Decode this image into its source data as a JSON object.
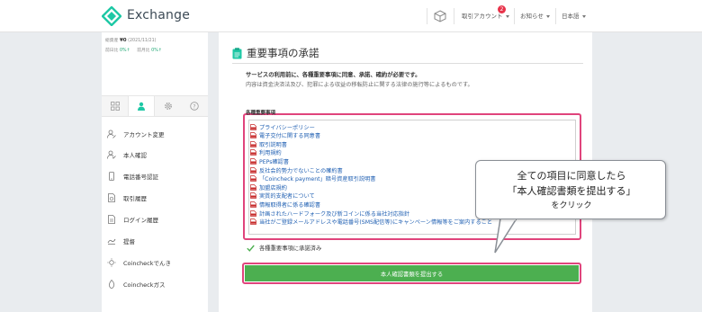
{
  "header": {
    "brand": "Exchange",
    "account_label": "取引アカウント",
    "account_badge": "2",
    "notice_label": "お知らせ",
    "language_label": "日本語",
    "brand_color": "#1ec8a5"
  },
  "sidebar": {
    "balance_label": "総資産",
    "balance_value": "¥0",
    "balance_date": "(2021/11/21)",
    "change_day_label": "前日比",
    "change_day_value": "0%↑",
    "change_month_label": "前月比",
    "change_month_value": "0%↑",
    "menu": [
      {
        "label": "アカウント変更",
        "icon": "user-edit-icon"
      },
      {
        "label": "本人確認",
        "icon": "user-check-icon"
      },
      {
        "label": "電話番号認証",
        "icon": "phone-icon"
      },
      {
        "label": "取引履歴",
        "icon": "history-icon"
      },
      {
        "label": "ログイン履歴",
        "icon": "login-history-icon"
      },
      {
        "label": "提督",
        "icon": "flag-icon"
      },
      {
        "label": "Coincheckでんき",
        "icon": "bulb-icon"
      },
      {
        "label": "Coincheckガス",
        "icon": "flame-icon"
      }
    ]
  },
  "main": {
    "title": "重要事項の承諾",
    "lead": "サービスの利用前に、各種重要事項に同意、承諾、確約が必要です。",
    "sub": "内容は資金決済法及び、犯罪による収益の移転防止に関する法律の施行等によるものです。",
    "docs_label": "各種重要事項",
    "docs": [
      "プライバシーポリシー",
      "電子交付に関する同意書",
      "取引説明書",
      "利用規約",
      "PEPs確認書",
      "反社会的勢力でないことの確約書",
      "「Coincheck payment」暗号資産取引説明書",
      "加盟店規約",
      "実質的支配者について",
      "情報取得者に係る確認書",
      "計画されたハードフォーク及び新コインに係る当社対応指針",
      "当社がご登録メールアドレスや電話番号(SMS配信等)にキャンペーン情報等をご案内すること"
    ],
    "accepted_text": "各種重要事項に承諾済み",
    "submit_label": "本人確認書類を提出する"
  },
  "callout": {
    "line1": "全ての項目に同意したら",
    "line2": "「本人確認書類を提出する」",
    "line3": "をクリック"
  },
  "colors": {
    "highlight": "#e0447c",
    "submit": "#4caf50",
    "link": "#1f5fb2"
  }
}
